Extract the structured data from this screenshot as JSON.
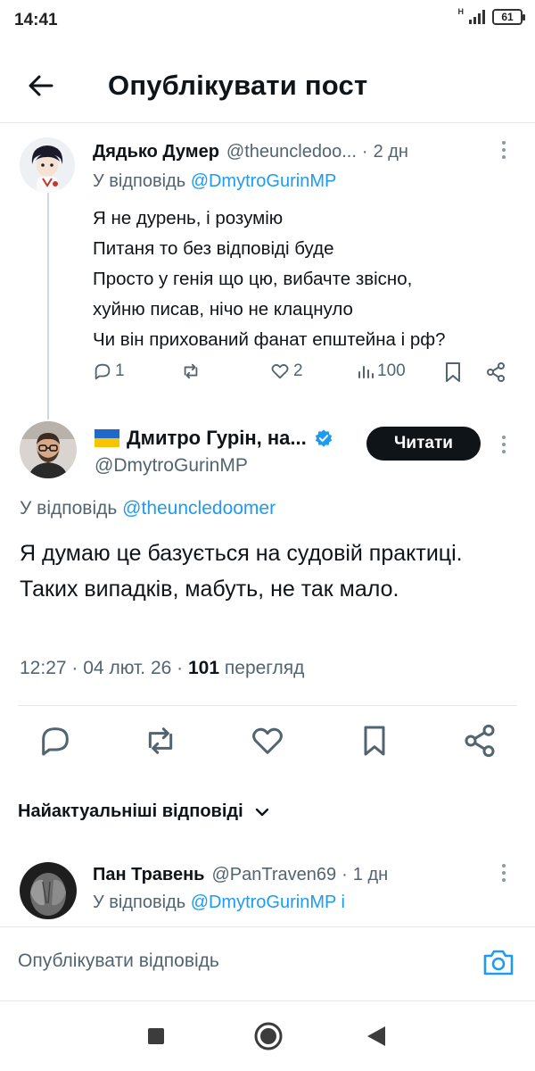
{
  "status_bar": {
    "time": "14:41",
    "battery": "61",
    "network": "H"
  },
  "header": {
    "title": "Опублікувати пост"
  },
  "tweet1": {
    "name": "Дядько Думер",
    "handle": "@theuncledoo...",
    "dot": "·",
    "time": "2 дн",
    "reply_prefix": "У відповідь",
    "reply_handle": "@DmytroGurinMP",
    "lines": [
      "Я не дурень, і розумію",
      "Питаня то без відповіді буде",
      "Просто у генія що цю, вибачте звісно,",
      "хуйню писав, нічо не клацнуло",
      "Чи він прихований фанат епштейна і рф?"
    ],
    "replies": "1",
    "likes": "2",
    "views": "100"
  },
  "main_tweet": {
    "flag": "🇺🇦",
    "name": "Дмитро Гурін, на...",
    "handle": "@DmytroGurinMP",
    "follow_label": "Читати",
    "reply_prefix": "У відповідь",
    "reply_handle": "@theuncledoomer",
    "text": "Я думаю це базується на судовій практиці. Таких випадків, мабуть, не так мало.",
    "time": "12:27",
    "date": "04 лют. 26",
    "views_count": "101",
    "views_label": "перегляд",
    "sep": "·"
  },
  "sort": {
    "label": "Найактуальніші відповіді"
  },
  "tweet3": {
    "name": "Пан Травень",
    "handle": "@PanTraven69",
    "dot": "·",
    "time": "1 дн",
    "reply_prefix": "У відповідь",
    "reply_handle": "@DmytroGurinMP і"
  },
  "compose": {
    "placeholder": "Опублікувати відповідь"
  },
  "colors": {
    "accent": "#1d9bf0",
    "text": "#0f1419",
    "muted": "#536471",
    "verified": "#1d9bf0"
  }
}
